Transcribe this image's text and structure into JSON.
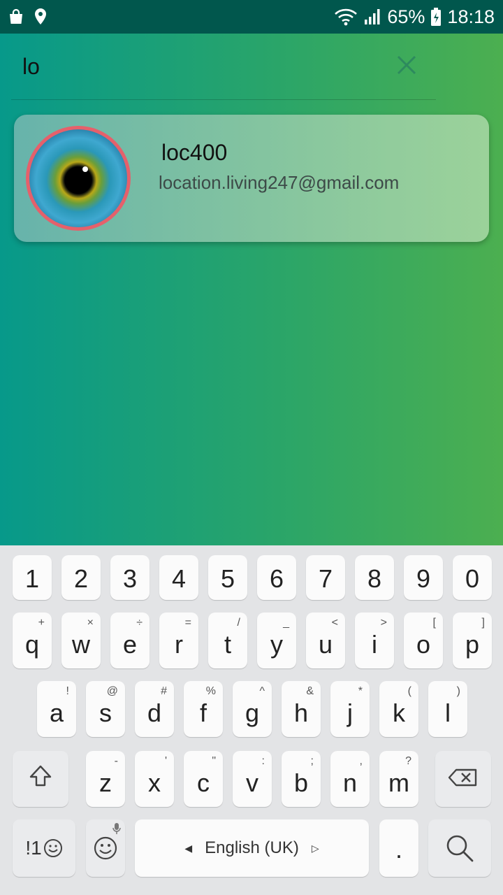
{
  "status_bar": {
    "left_icons": [
      "shopping-bag-icon",
      "location-pin-icon"
    ],
    "right_icons": [
      "wifi-icon",
      "signal-icon"
    ],
    "battery_percent": "65%",
    "time": "18:18"
  },
  "search": {
    "query": "lo",
    "clear_icon": "close-icon"
  },
  "results": [
    {
      "name": "loc400",
      "email": "location.living247@gmail.com",
      "avatar_icon": "eye-avatar"
    }
  ],
  "keyboard": {
    "number_row": [
      "1",
      "2",
      "3",
      "4",
      "5",
      "6",
      "7",
      "8",
      "9",
      "0"
    ],
    "row1": [
      {
        "main": "q",
        "sub": "+"
      },
      {
        "main": "w",
        "sub": "×"
      },
      {
        "main": "e",
        "sub": "÷"
      },
      {
        "main": "r",
        "sub": "="
      },
      {
        "main": "t",
        "sub": "/"
      },
      {
        "main": "y",
        "sub": "_"
      },
      {
        "main": "u",
        "sub": "<"
      },
      {
        "main": "i",
        "sub": ">"
      },
      {
        "main": "o",
        "sub": "["
      },
      {
        "main": "p",
        "sub": "]"
      }
    ],
    "row2": [
      {
        "main": "a",
        "sub": "!"
      },
      {
        "main": "s",
        "sub": "@"
      },
      {
        "main": "d",
        "sub": "#"
      },
      {
        "main": "f",
        "sub": "%"
      },
      {
        "main": "g",
        "sub": "^"
      },
      {
        "main": "h",
        "sub": "&"
      },
      {
        "main": "j",
        "sub": "*"
      },
      {
        "main": "k",
        "sub": "("
      },
      {
        "main": "l",
        "sub": ")"
      }
    ],
    "row3": [
      {
        "main": "z",
        "sub": "-"
      },
      {
        "main": "x",
        "sub": "'"
      },
      {
        "main": "c",
        "sub": "\""
      },
      {
        "main": "v",
        "sub": ":"
      },
      {
        "main": "b",
        "sub": ";"
      },
      {
        "main": "n",
        "sub": ","
      },
      {
        "main": "m",
        "sub": "?"
      }
    ],
    "symbols_label": "!1",
    "space_label": "English (UK)",
    "period_label": ".",
    "colors": {
      "background": "#e3e4e6",
      "key": "#fbfbfb",
      "func_key": "#eaebed"
    }
  }
}
